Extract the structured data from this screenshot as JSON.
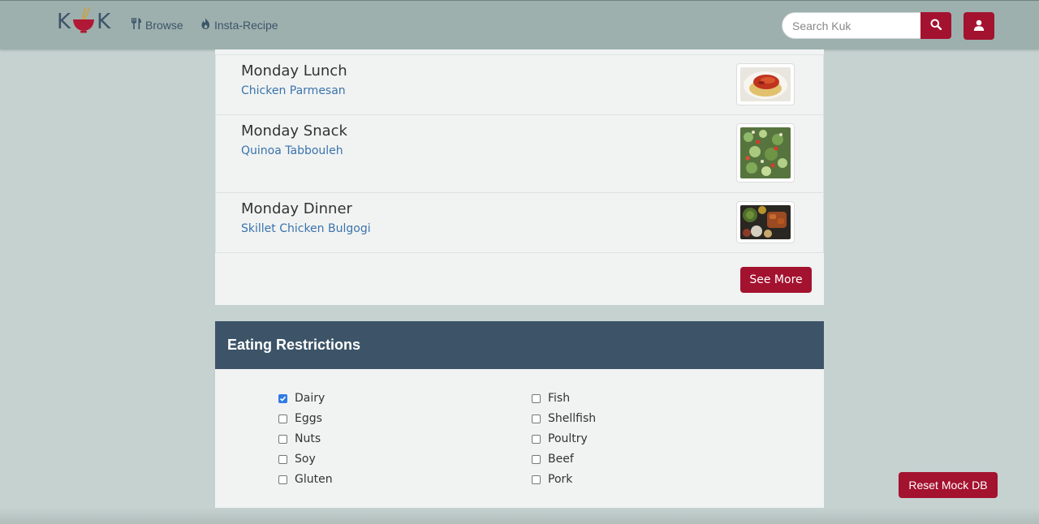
{
  "navbar": {
    "logo_left": "K",
    "logo_right": "K",
    "browse_label": "Browse",
    "insta_label": "Insta-Recipe",
    "search_placeholder": "Search Kuk",
    "search_value": "",
    "accent_color": "#a3122f",
    "icons": [
      "cutlery-icon",
      "fire-icon",
      "search-icon",
      "user-icon"
    ]
  },
  "meals": [
    {
      "title": "Monday Lunch",
      "recipe": "Chicken Parmesan"
    },
    {
      "title": "Monday Snack",
      "recipe": "Quinoa Tabbouleh"
    },
    {
      "title": "Monday Dinner",
      "recipe": "Skillet Chicken Bulgogi"
    }
  ],
  "see_more_label": "See More",
  "restrictions": {
    "title": "Eating Restrictions",
    "left": [
      {
        "label": "Dairy",
        "checked": true
      },
      {
        "label": "Eggs",
        "checked": false
      },
      {
        "label": "Nuts",
        "checked": false
      },
      {
        "label": "Soy",
        "checked": false
      },
      {
        "label": "Gluten",
        "checked": false
      }
    ],
    "right": [
      {
        "label": "Fish",
        "checked": false
      },
      {
        "label": "Shellfish",
        "checked": false
      },
      {
        "label": "Poultry",
        "checked": false
      },
      {
        "label": "Beef",
        "checked": false
      },
      {
        "label": "Pork",
        "checked": false
      }
    ]
  },
  "reset_label": "Reset Mock DB",
  "colors": {
    "navbar": "#9db0ae",
    "page_bg": "#c5d2d0",
    "panel_header": "#3d5468",
    "link": "#3a73ad",
    "checkbox_checked": "#2f7ae5"
  }
}
